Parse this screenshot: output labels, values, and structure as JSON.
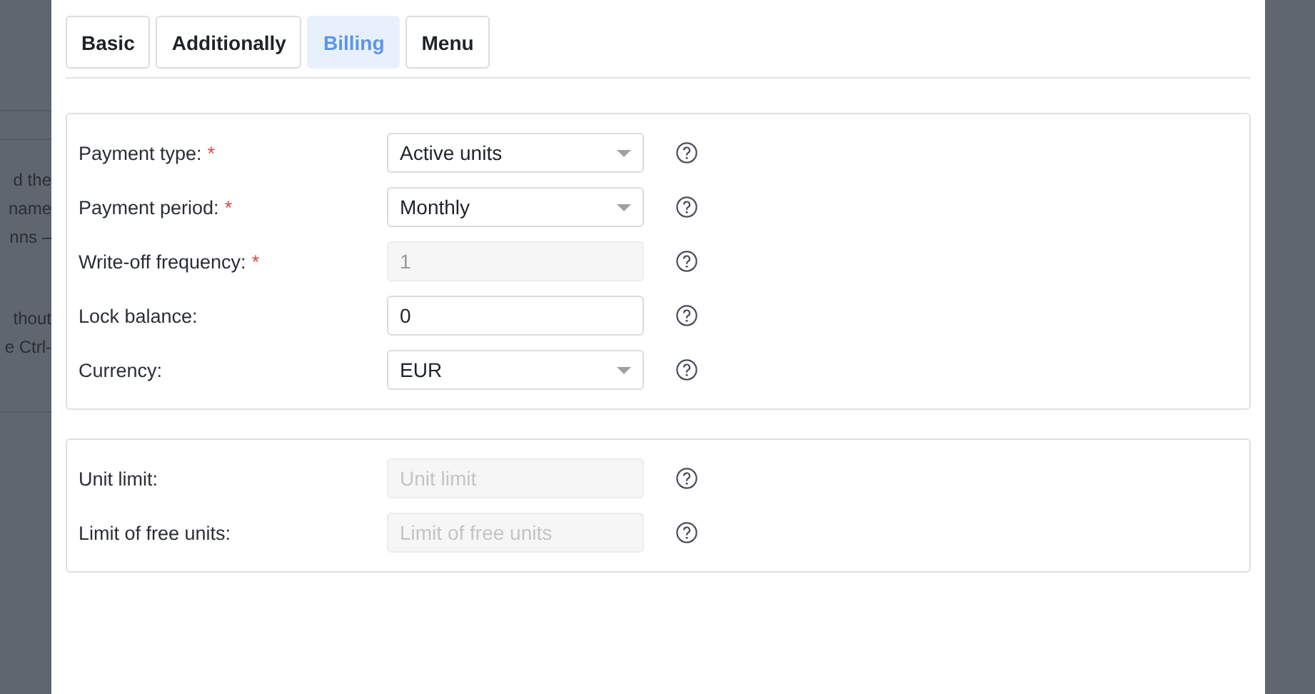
{
  "background_page": {
    "paragraphs": [
      {
        "lines": [
          "d the",
          "name",
          "nns –"
        ]
      },
      {
        "lines": [
          "thout",
          "e Ctrl-"
        ]
      }
    ]
  },
  "tabs": [
    {
      "label": "Basic",
      "selected": false
    },
    {
      "label": "Additionally",
      "selected": false
    },
    {
      "label": "Billing",
      "selected": true
    },
    {
      "label": "Menu",
      "selected": false
    }
  ],
  "panels": [
    {
      "fields": [
        {
          "label": "Payment type:",
          "required_mark": "*",
          "kind": "select",
          "value": "Active units",
          "disabled": false
        },
        {
          "label": "Payment period:",
          "required_mark": "*",
          "kind": "select",
          "value": "Monthly",
          "disabled": false
        },
        {
          "label": "Write-off frequency:",
          "required_mark": "*",
          "kind": "input",
          "value": "1",
          "disabled": true
        },
        {
          "label": "Lock balance:",
          "kind": "input",
          "value": "0",
          "disabled": false
        },
        {
          "label": "Currency:",
          "kind": "select",
          "value": "EUR",
          "disabled": false
        }
      ]
    },
    {
      "fields": [
        {
          "label": "Unit limit:",
          "kind": "input",
          "placeholder": "Unit limit",
          "disabled": true
        },
        {
          "label": "Limit of free units:",
          "kind": "input",
          "placeholder": "Limit of free units",
          "disabled": true
        }
      ]
    }
  ]
}
